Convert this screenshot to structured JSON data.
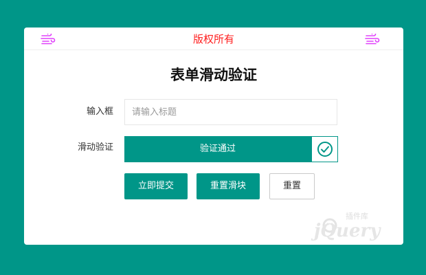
{
  "header": {
    "text": "版权所有",
    "left_icon": "wind-icon",
    "right_icon": "wind-icon",
    "icon_color": "#e040fb",
    "text_color": "#ff1f1f"
  },
  "form": {
    "title": "表单滑动验证",
    "input_label": "输入框",
    "input_placeholder": "请输入标题",
    "input_value": "",
    "slider_label": "滑动验证",
    "slider_text": "验证通过",
    "slider_icon": "check-circle-icon",
    "accent_color": "#009688"
  },
  "buttons": {
    "submit": "立即提交",
    "reset_slider": "重置滑块",
    "reset": "重置"
  },
  "watermark": {
    "logo": "jquery-logo",
    "text": "jQuery",
    "sub_text": "插件库"
  }
}
